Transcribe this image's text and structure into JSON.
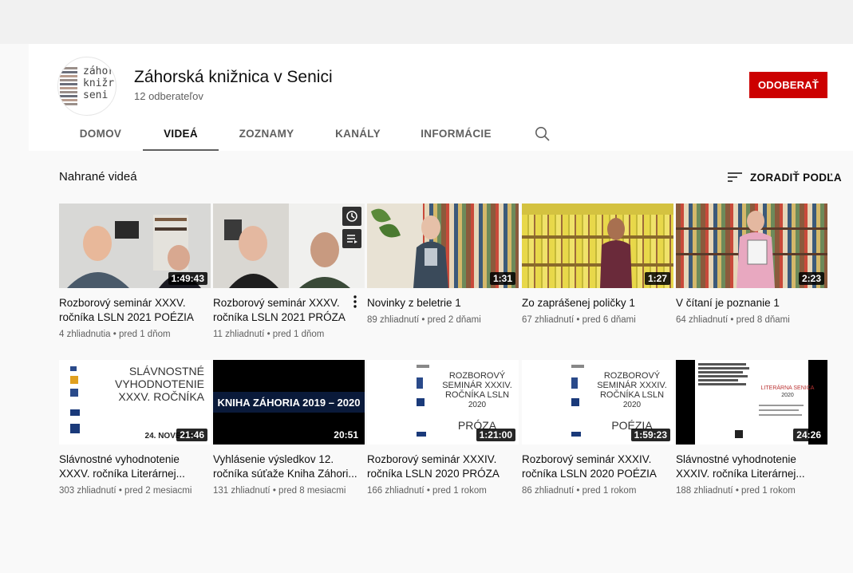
{
  "channel": {
    "name": "Záhorská knižnica v Senici",
    "subscribers": "12 odberateľov",
    "logo_text": "záhor\nknižr\nseni",
    "subscribe_label": "ODOBERAŤ"
  },
  "tabs": [
    {
      "label": "DOMOV"
    },
    {
      "label": "VIDEÁ"
    },
    {
      "label": "ZOZNAMY"
    },
    {
      "label": "KANÁLY"
    },
    {
      "label": "INFORMÁCIE"
    }
  ],
  "section": {
    "title": "Nahrané videá",
    "sort_label": "ZORADIŤ PODĽA"
  },
  "videos": [
    {
      "title": "Rozborový seminár XXXV. ročníka LSLN 2021 POÉZIA",
      "duration": "1:49:43",
      "views": "4 zhliadnutia",
      "age": "pred 1 dňom"
    },
    {
      "title": "Rozborový seminár XXXV. ročníka LSLN 2021 PRÓZA",
      "duration": "",
      "views": "11 zhliadnutí",
      "age": "pred 1 dňom"
    },
    {
      "title": "Novinky z beletrie 1",
      "duration": "1:31",
      "views": "89 zhliadnutí",
      "age": "pred 2 dňami"
    },
    {
      "title": "Zo zaprášenej poličky 1",
      "duration": "1:27",
      "views": "67 zhliadnutí",
      "age": "pred 6 dňami"
    },
    {
      "title": "V čítaní je poznanie 1",
      "duration": "2:23",
      "views": "64 zhliadnutí",
      "age": "pred 8 dňami"
    },
    {
      "title": "Slávnostné vyhodnotenie XXXV. ročníka Literárnej...",
      "duration": "21:46",
      "views": "303 zhliadnutí",
      "age": "pred 2 mesiacmi"
    },
    {
      "title": "Vyhlásenie výsledkov 12. ročníka súťaže Kniha Záhori...",
      "duration": "20:51",
      "views": "131 zhliadnutí",
      "age": "pred 8 mesiacmi"
    },
    {
      "title": "Rozborový seminár XXXIV. ročníka LSLN 2020 PRÓZA",
      "duration": "1:21:00",
      "views": "166 zhliadnutí",
      "age": "pred 1 rokom"
    },
    {
      "title": "Rozborový seminár XXXIV. ročníka LSLN 2020 POÉZIA",
      "duration": "1:59:23",
      "views": "86 zhliadnutí",
      "age": "pred 1 rokom"
    },
    {
      "title": "Slávnostné vyhodnotenie XXXIV. ročníka Literárnej...",
      "duration": "24:26",
      "views": "188 zhliadnutí",
      "age": "pred 1 rokom"
    }
  ],
  "thumb_text": {
    "t6": [
      "SLÁVNOSTNÉ",
      "VYHODNOTENIE",
      "XXXV. ROČNÍKA",
      "24. NOVEMBER"
    ],
    "t7": "KNIHA ZÁHORIA 2019 – 2020",
    "t8": [
      "ROZBOROVÝ",
      "SEMINÁR XXXIV.",
      "ROČNÍKA LSLN",
      "2020",
      "PRÓZA"
    ],
    "t9": [
      "ROZBOROVÝ",
      "SEMINÁR XXXIV.",
      "ROČNÍKA LSLN",
      "2020",
      "POÉZIA"
    ],
    "t10": [
      "LITERÁRNA SENICA",
      "2020"
    ]
  },
  "colors": {
    "subscribe": "#cc0000",
    "background": "#f9f9f9",
    "header": "#ffffff",
    "meta_text": "#606060"
  }
}
